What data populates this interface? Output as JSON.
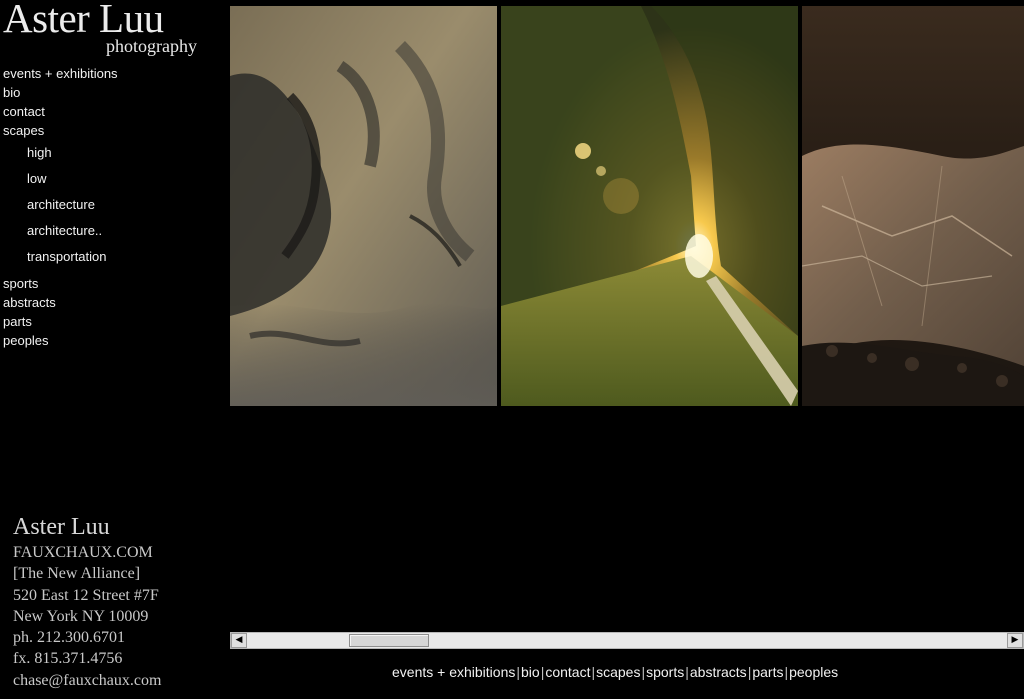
{
  "logo": {
    "name": "Aster Luu",
    "subtitle": "photography"
  },
  "nav": {
    "items": [
      {
        "label": "events + exhibitions"
      },
      {
        "label": "bio"
      },
      {
        "label": "contact"
      },
      {
        "label": "scapes"
      }
    ],
    "scapes_sub": [
      {
        "label": "high"
      },
      {
        "label": "low"
      },
      {
        "label": "architecture"
      },
      {
        "label": "architecture.."
      },
      {
        "label": "transportation"
      }
    ],
    "items_after": [
      {
        "label": "sports"
      },
      {
        "label": "abstracts"
      },
      {
        "label": "parts"
      },
      {
        "label": "peoples"
      }
    ]
  },
  "contact": {
    "name": "Aster Luu",
    "lines": [
      "FAUXCHAUX.COM",
      "[The New Alliance]",
      "520 East 12 Street #7F",
      "New York NY 10009",
      "ph. 212.300.6701",
      "fx.  815.371.4756",
      "chase@fauxchaux.com"
    ]
  },
  "scrollbar": {
    "position": 0.15,
    "left_arrow": "◀",
    "right_arrow": "▶"
  },
  "footer_nav": {
    "items": [
      "events + exhibitions",
      "bio",
      "contact",
      "scapes",
      "sports",
      "abstracts",
      "parts",
      "peoples"
    ],
    "separator": "|"
  }
}
